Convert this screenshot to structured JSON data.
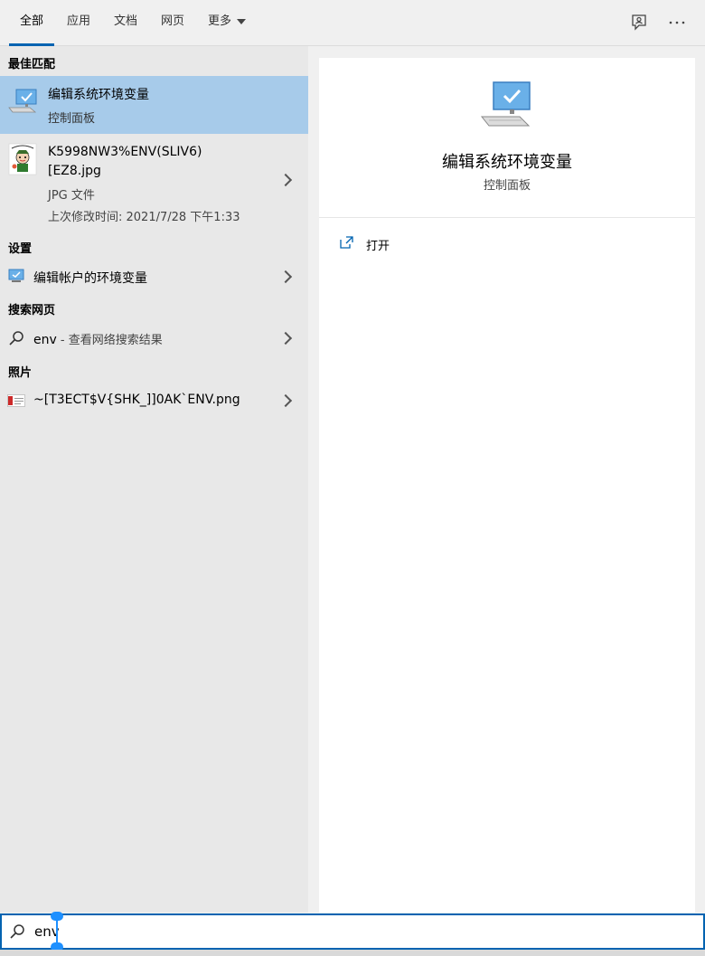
{
  "tabs": [
    {
      "label": "全部"
    },
    {
      "label": "应用"
    },
    {
      "label": "文档"
    },
    {
      "label": "网页"
    },
    {
      "label": "更多"
    }
  ],
  "top_icons": [
    "feedback-icon",
    "more-options-icon"
  ],
  "sections": {
    "best_match": "最佳匹配",
    "settings": "设置",
    "web": "搜索网页",
    "photos": "照片"
  },
  "best_match": {
    "title": "编辑系统环境变量",
    "subtitle": "控制面板"
  },
  "file_result": {
    "name_line1": "K5998NW3%ENV(SLIV6)",
    "name_line2": "[EZ8.jpg",
    "type": "JPG 文件",
    "modified": "上次修改时间: 2021/7/28 下午1:33"
  },
  "settings_result": {
    "label": "编辑帐户的环境变量"
  },
  "web_result": {
    "query": "env",
    "suffix": " - 查看网络搜索结果"
  },
  "photo_result": {
    "name": "~[T3ECT$V{SHK_]]0AK`ENV.png"
  },
  "detail": {
    "title": "编辑系统环境变量",
    "subtitle": "控制面板",
    "open_label": "打开"
  },
  "search": {
    "value": "env"
  },
  "colors": {
    "accent": "#0063b1",
    "selected_bg": "#a7cbea",
    "left_bg": "#e8e8e8",
    "right_bg": "#ffffff"
  }
}
